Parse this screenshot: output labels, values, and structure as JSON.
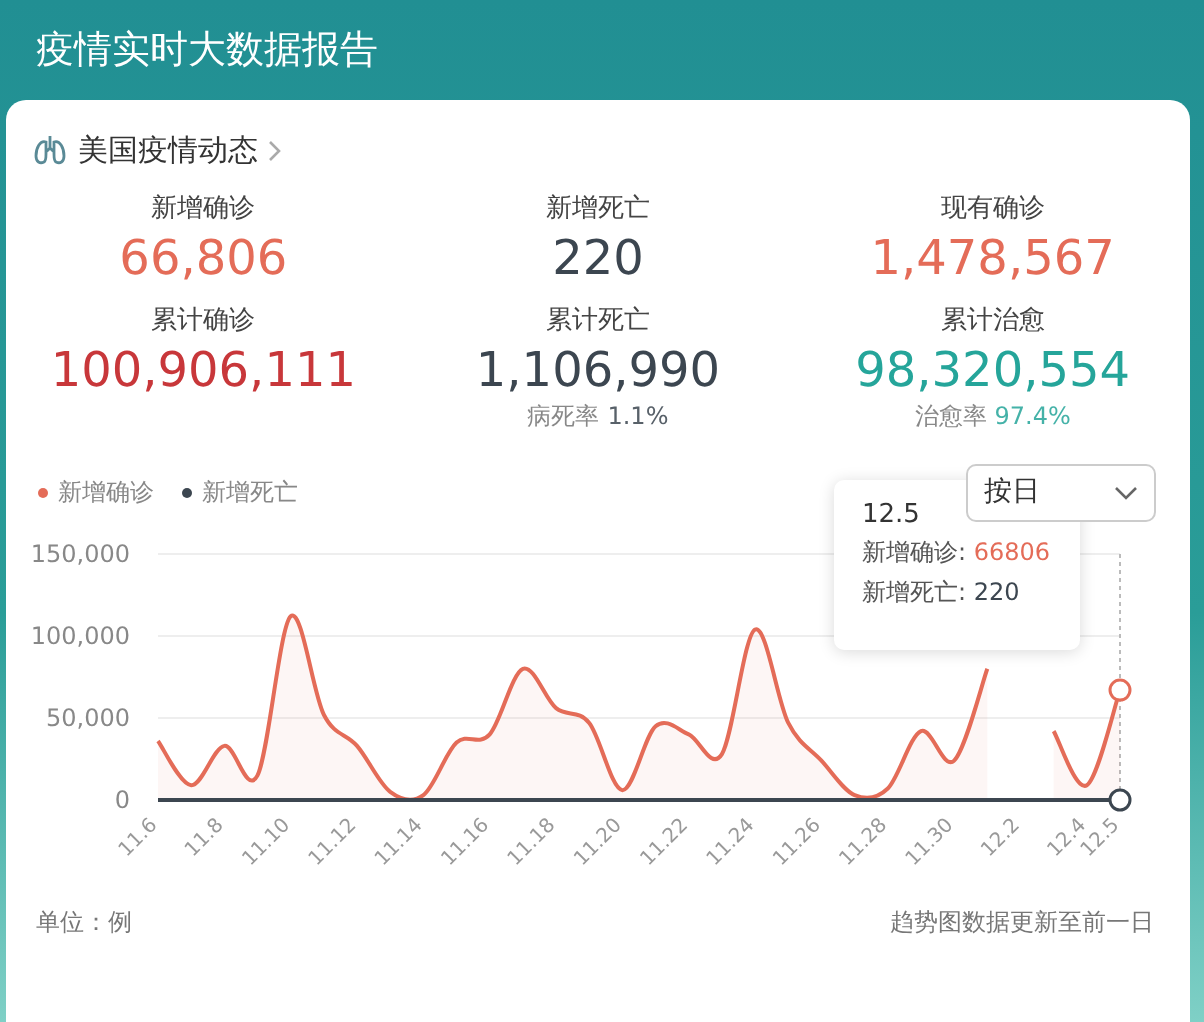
{
  "header": {
    "title": "疫情实时大数据报告"
  },
  "section": {
    "title": "美国疫情动态"
  },
  "stats": [
    {
      "label": "新增确诊",
      "value": "66,806",
      "color": "#e46c58"
    },
    {
      "label": "新增死亡",
      "value": "220",
      "color": "#3c4650"
    },
    {
      "label": "现有确诊",
      "value": "1,478,567",
      "color": "#e46c58"
    },
    {
      "label": "累计确诊",
      "value": "100,906,111",
      "color": "#c8373a"
    },
    {
      "label": "累计死亡",
      "value": "1,106,990",
      "color": "#3c4650",
      "sub_label": "病死率",
      "sub_value": "1.1%"
    },
    {
      "label": "累计治愈",
      "value": "98,320,554",
      "color": "#25a59a",
      "sub_label": "治愈率",
      "sub_value": "97.4%"
    }
  ],
  "dropdown": {
    "value": "按日"
  },
  "chart_data": {
    "type": "line",
    "categories": [
      "11.6",
      null,
      "11.8",
      null,
      "11.10",
      null,
      "11.12",
      null,
      "11.14",
      null,
      "11.16",
      null,
      "11.18",
      null,
      "11.20",
      null,
      "11.22",
      null,
      "11.24",
      null,
      "11.26",
      null,
      "11.28",
      null,
      "11.30",
      null,
      "12.2",
      null,
      "12.4",
      "12.5"
    ],
    "ylim": [
      0,
      150000
    ],
    "yticks": [
      {
        "value": 0,
        "label": "0"
      },
      {
        "value": 50000,
        "label": "50,000"
      },
      {
        "value": 100000,
        "label": "100,000"
      },
      {
        "value": 150000,
        "label": "150,000"
      }
    ],
    "series": [
      {
        "name": "新增确诊",
        "color": "#e46c58",
        "values": [
          36000,
          9000,
          33000,
          15000,
          112000,
          52000,
          33000,
          5000,
          3000,
          35000,
          40000,
          80000,
          56000,
          47000,
          6000,
          45000,
          40000,
          28000,
          104000,
          47000,
          24000,
          3000,
          7000,
          42000,
          24000,
          80000,
          null,
          42000,
          9000,
          67000
        ]
      },
      {
        "name": "新增死亡",
        "color": "#3c4650",
        "values": [
          0,
          0,
          0,
          0,
          0,
          0,
          0,
          0,
          0,
          0,
          0,
          0,
          0,
          0,
          0,
          0,
          0,
          0,
          0,
          0,
          0,
          0,
          0,
          0,
          0,
          0,
          0,
          0,
          0,
          0
        ]
      }
    ]
  },
  "tooltip": {
    "title": "12.5",
    "rows": [
      {
        "label": "新增确诊:",
        "value": "66806",
        "color": "#e46c58"
      },
      {
        "label": "新增死亡:",
        "value": "220",
        "color": "#3c4650"
      }
    ]
  },
  "footer": {
    "unit": "单位：例",
    "note": "趋势图数据更新至前一日"
  }
}
